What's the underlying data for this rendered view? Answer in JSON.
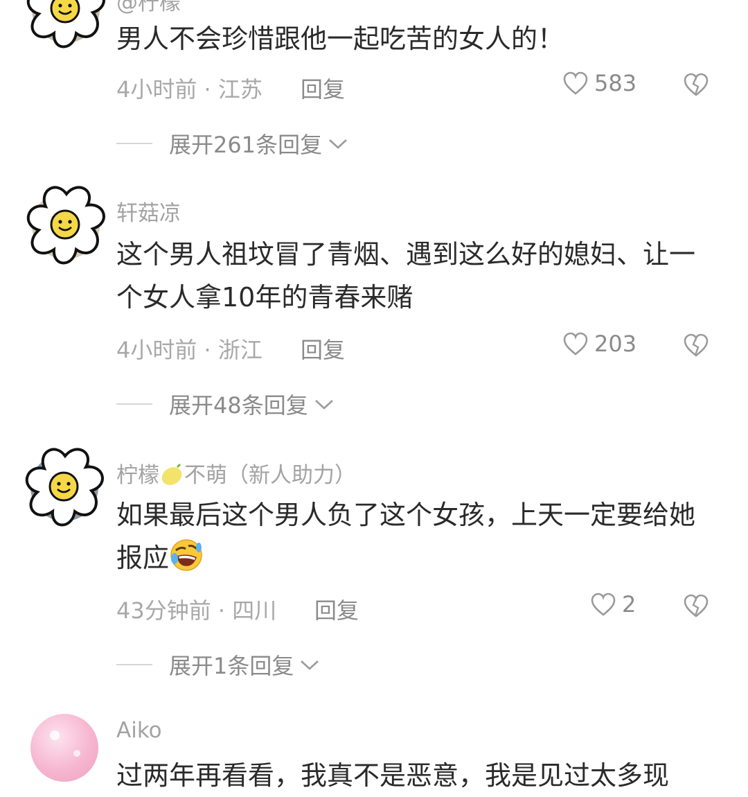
{
  "comments": [
    {
      "username": "@柠檬",
      "text": "男人不会珍惜跟他一起吃苦的女人的！",
      "time": "4小时前",
      "location": "江苏",
      "reply_label": "回复",
      "likes": "583",
      "expand": "展开261条回复"
    },
    {
      "username": "轩菇凉",
      "text": "这个男人祖坟冒了青烟、遇到这么好的媳妇、让一个女人拿10年的青春来赌",
      "time": "4小时前",
      "location": "浙江",
      "reply_label": "回复",
      "likes": "203",
      "expand": "展开48条回复"
    },
    {
      "username_prefix": "柠檬",
      "username_suffix": "不萌（新人助力）",
      "text": "如果最后这个男人负了这个女孩，上天一定要给她报应",
      "time": "43分钟前",
      "location": "四川",
      "reply_label": "回复",
      "likes": "2",
      "expand": "展开1条回复"
    },
    {
      "username": "Aiko",
      "text": "过两年再看看，我真不是恶意，我是见过太多现"
    }
  ],
  "separator": " · ",
  "icons": {
    "like": "heart-outline-icon",
    "dislike": "broken-heart-icon",
    "expand": "chevron-down-icon",
    "lemon": "lemon-emoji",
    "laugh": "rolling-laughing-emoji"
  },
  "colors": {
    "username": "#a3a3a3",
    "text": "#2a2a2a",
    "meta": "#a8a8a8",
    "action": "#8a8a8a"
  }
}
